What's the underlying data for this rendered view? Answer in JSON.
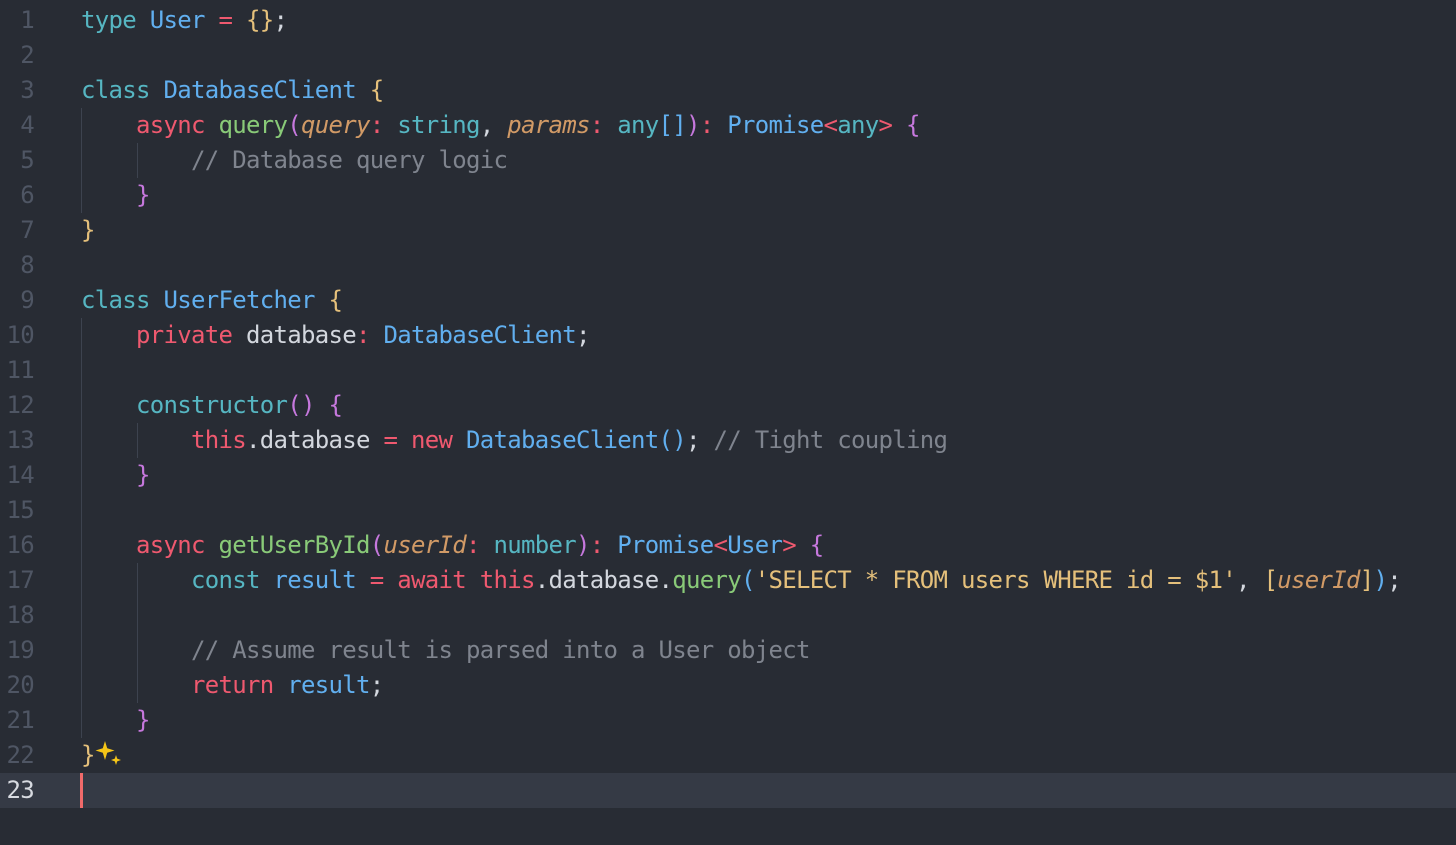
{
  "editor": {
    "language": "typescript",
    "current_line": 23,
    "colors": {
      "background": "#282c34",
      "current_line_bg": "#353a45",
      "keyword": "#56b6c2",
      "keyword_red": "#ef596f",
      "type": "#61afef",
      "function": "#89ca78",
      "parameter": "#d19a66",
      "comment": "#7f848e",
      "string": "#e5c07b",
      "cursor": "#f06a6a"
    },
    "lines": [
      {
        "n": "1",
        "tokens": [
          [
            "kw",
            "type"
          ],
          [
            "p",
            " "
          ],
          [
            "ty",
            "User"
          ],
          [
            "p",
            " "
          ],
          [
            "op",
            "="
          ],
          [
            "p",
            " "
          ],
          [
            "br1",
            "{}"
          ],
          [
            "p",
            ";"
          ]
        ]
      },
      {
        "n": "2",
        "tokens": []
      },
      {
        "n": "3",
        "tokens": [
          [
            "kw",
            "class"
          ],
          [
            "p",
            " "
          ],
          [
            "ty",
            "DatabaseClient"
          ],
          [
            "p",
            " "
          ],
          [
            "br1",
            "{"
          ]
        ]
      },
      {
        "n": "4",
        "tokens": [
          [
            "p",
            "    "
          ],
          [
            "kr",
            "async"
          ],
          [
            "p",
            " "
          ],
          [
            "fn",
            "query"
          ],
          [
            "br2",
            "("
          ],
          [
            "pa",
            "query"
          ],
          [
            "op",
            ":"
          ],
          [
            "p",
            " "
          ],
          [
            "kw",
            "string"
          ],
          [
            "p",
            ", "
          ],
          [
            "pa",
            "params"
          ],
          [
            "op",
            ":"
          ],
          [
            "p",
            " "
          ],
          [
            "kw",
            "any"
          ],
          [
            "br3",
            "[]"
          ],
          [
            "br2",
            ")"
          ],
          [
            "op",
            ":"
          ],
          [
            "p",
            " "
          ],
          [
            "ty",
            "Promise"
          ],
          [
            "op",
            "<"
          ],
          [
            "kw",
            "any"
          ],
          [
            "op",
            ">"
          ],
          [
            "p",
            " "
          ],
          [
            "br2",
            "{"
          ]
        ]
      },
      {
        "n": "5",
        "tokens": [
          [
            "p",
            "        "
          ],
          [
            "cm",
            "// Database query logic"
          ]
        ]
      },
      {
        "n": "6",
        "tokens": [
          [
            "p",
            "    "
          ],
          [
            "br2",
            "}"
          ]
        ]
      },
      {
        "n": "7",
        "tokens": [
          [
            "br1",
            "}"
          ]
        ]
      },
      {
        "n": "8",
        "tokens": []
      },
      {
        "n": "9",
        "tokens": [
          [
            "kw",
            "class"
          ],
          [
            "p",
            " "
          ],
          [
            "ty",
            "UserFetcher"
          ],
          [
            "p",
            " "
          ],
          [
            "br1",
            "{"
          ]
        ]
      },
      {
        "n": "10",
        "tokens": [
          [
            "p",
            "    "
          ],
          [
            "kr",
            "private"
          ],
          [
            "p",
            " database"
          ],
          [
            "op",
            ":"
          ],
          [
            "p",
            " "
          ],
          [
            "ty",
            "DatabaseClient"
          ],
          [
            "p",
            ";"
          ]
        ]
      },
      {
        "n": "11",
        "tokens": []
      },
      {
        "n": "12",
        "tokens": [
          [
            "p",
            "    "
          ],
          [
            "kw",
            "constructor"
          ],
          [
            "br2",
            "()"
          ],
          [
            "p",
            " "
          ],
          [
            "br2",
            "{"
          ]
        ]
      },
      {
        "n": "13",
        "tokens": [
          [
            "p",
            "        "
          ],
          [
            "kr",
            "this"
          ],
          [
            "p",
            ".database "
          ],
          [
            "op",
            "="
          ],
          [
            "p",
            " "
          ],
          [
            "kr",
            "new"
          ],
          [
            "p",
            " "
          ],
          [
            "ty",
            "DatabaseClient"
          ],
          [
            "br3",
            "()"
          ],
          [
            "p",
            "; "
          ],
          [
            "cm",
            "// Tight coupling"
          ]
        ]
      },
      {
        "n": "14",
        "tokens": [
          [
            "p",
            "    "
          ],
          [
            "br2",
            "}"
          ]
        ]
      },
      {
        "n": "15",
        "tokens": []
      },
      {
        "n": "16",
        "tokens": [
          [
            "p",
            "    "
          ],
          [
            "kr",
            "async"
          ],
          [
            "p",
            " "
          ],
          [
            "fn",
            "getUserById"
          ],
          [
            "br2",
            "("
          ],
          [
            "pa",
            "userId"
          ],
          [
            "op",
            ":"
          ],
          [
            "p",
            " "
          ],
          [
            "kw",
            "number"
          ],
          [
            "br2",
            ")"
          ],
          [
            "op",
            ":"
          ],
          [
            "p",
            " "
          ],
          [
            "ty",
            "Promise"
          ],
          [
            "op",
            "<"
          ],
          [
            "ty",
            "User"
          ],
          [
            "op",
            ">"
          ],
          [
            "p",
            " "
          ],
          [
            "br2",
            "{"
          ]
        ]
      },
      {
        "n": "17",
        "tokens": [
          [
            "p",
            "        "
          ],
          [
            "kw",
            "const"
          ],
          [
            "p",
            " "
          ],
          [
            "ty",
            "result"
          ],
          [
            "p",
            " "
          ],
          [
            "op",
            "="
          ],
          [
            "p",
            " "
          ],
          [
            "kr",
            "await"
          ],
          [
            "p",
            " "
          ],
          [
            "kr",
            "this"
          ],
          [
            "p",
            ".database."
          ],
          [
            "fn",
            "query"
          ],
          [
            "br3",
            "("
          ],
          [
            "st",
            "'SELECT * FROM users WHERE id = $1'"
          ],
          [
            "p",
            ", "
          ],
          [
            "br1",
            "["
          ],
          [
            "pa",
            "userId"
          ],
          [
            "br1",
            "]"
          ],
          [
            "br3",
            ")"
          ],
          [
            "p",
            ";"
          ]
        ]
      },
      {
        "n": "18",
        "tokens": []
      },
      {
        "n": "19",
        "tokens": [
          [
            "p",
            "        "
          ],
          [
            "cm",
            "// Assume result is parsed into a User object"
          ]
        ]
      },
      {
        "n": "20",
        "tokens": [
          [
            "p",
            "        "
          ],
          [
            "kr",
            "return"
          ],
          [
            "p",
            " "
          ],
          [
            "ty",
            "result"
          ],
          [
            "p",
            ";"
          ]
        ]
      },
      {
        "n": "21",
        "tokens": [
          [
            "p",
            "    "
          ],
          [
            "br2",
            "}"
          ]
        ]
      },
      {
        "n": "22",
        "tokens": [
          [
            "br1",
            "}"
          ]
        ]
      },
      {
        "n": "23",
        "tokens": []
      }
    ],
    "ai_suggestion_icon": "sparkle-icon"
  }
}
